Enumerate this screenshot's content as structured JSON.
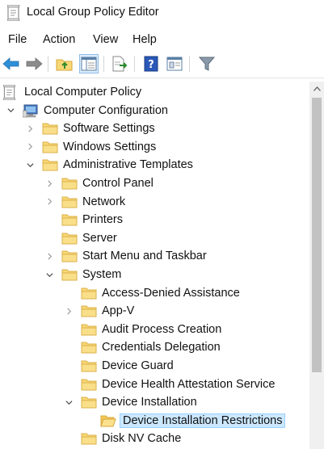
{
  "window": {
    "title": "Local Group Policy Editor"
  },
  "menu": [
    "File",
    "Action",
    "View",
    "Help"
  ],
  "toolbar": [
    "back-icon",
    "forward-icon",
    "up-folder-icon",
    "show-hide-tree-icon",
    "export-list-icon",
    "help-icon",
    "properties-icon",
    "filter-icon"
  ],
  "tree": [
    {
      "label": "Local Computer Policy",
      "icon": "policy",
      "expander": "none",
      "depth": 0
    },
    {
      "label": "Computer Configuration",
      "icon": "computer",
      "expander": "expanded",
      "depth": 1
    },
    {
      "label": "Software Settings",
      "icon": "folder",
      "expander": "collapsed",
      "depth": 2
    },
    {
      "label": "Windows Settings",
      "icon": "folder",
      "expander": "collapsed",
      "depth": 2
    },
    {
      "label": "Administrative Templates",
      "icon": "folder",
      "expander": "expanded",
      "depth": 2
    },
    {
      "label": "Control Panel",
      "icon": "folder",
      "expander": "collapsed",
      "depth": 3
    },
    {
      "label": "Network",
      "icon": "folder",
      "expander": "collapsed",
      "depth": 3
    },
    {
      "label": "Printers",
      "icon": "folder",
      "expander": "none",
      "depth": 3
    },
    {
      "label": "Server",
      "icon": "folder",
      "expander": "none",
      "depth": 3
    },
    {
      "label": "Start Menu and Taskbar",
      "icon": "folder",
      "expander": "collapsed",
      "depth": 3
    },
    {
      "label": "System",
      "icon": "folder",
      "expander": "expanded",
      "depth": 3
    },
    {
      "label": "Access-Denied Assistance",
      "icon": "folder",
      "expander": "none",
      "depth": 4
    },
    {
      "label": "App-V",
      "icon": "folder",
      "expander": "collapsed",
      "depth": 4
    },
    {
      "label": "Audit Process Creation",
      "icon": "folder",
      "expander": "none",
      "depth": 4
    },
    {
      "label": "Credentials Delegation",
      "icon": "folder",
      "expander": "none",
      "depth": 4
    },
    {
      "label": "Device Guard",
      "icon": "folder",
      "expander": "none",
      "depth": 4
    },
    {
      "label": "Device Health Attestation Service",
      "icon": "folder",
      "expander": "none",
      "depth": 4
    },
    {
      "label": "Device Installation",
      "icon": "folder",
      "expander": "expanded",
      "depth": 4
    },
    {
      "label": "Device Installation Restrictions",
      "icon": "folder-open",
      "expander": "none",
      "depth": 5,
      "selected": true
    },
    {
      "label": "Disk NV Cache",
      "icon": "folder",
      "expander": "none",
      "depth": 4
    }
  ],
  "colors": {
    "selection_bg": "#cce8ff",
    "selection_border": "#99d1ff",
    "folder": "#f8d775",
    "folder_edge": "#e0b84a"
  }
}
